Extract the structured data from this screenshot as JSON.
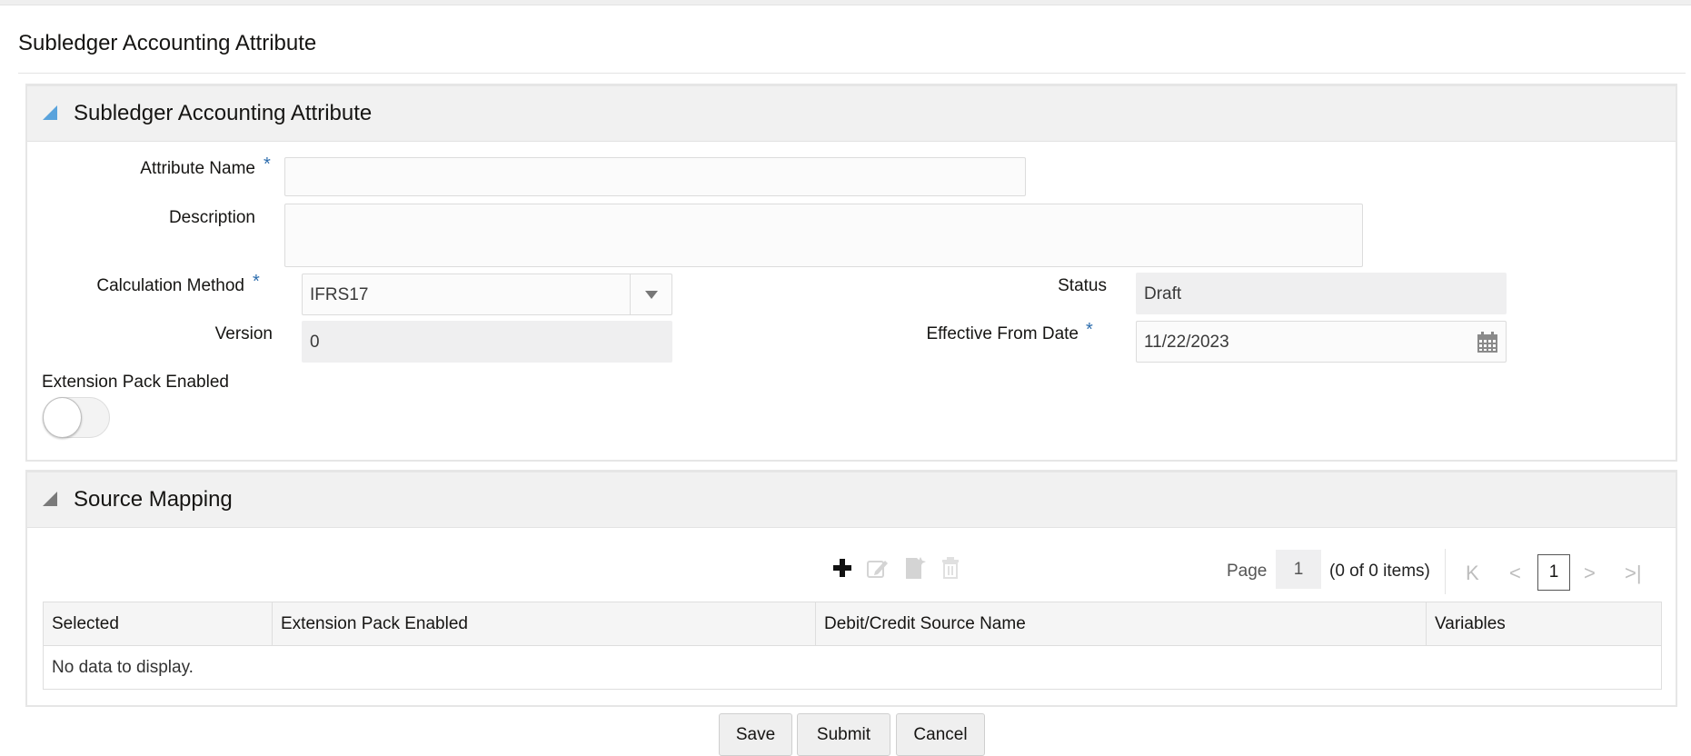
{
  "page": {
    "title": "Subledger Accounting Attribute"
  },
  "details_panel": {
    "title": "Subledger Accounting Attribute",
    "attribute_name": {
      "label": "Attribute Name",
      "required": "*",
      "value": ""
    },
    "description": {
      "label": "Description",
      "value": ""
    },
    "calculation_method": {
      "label": "Calculation Method",
      "required": "*",
      "value": "IFRS17"
    },
    "version": {
      "label": "Version",
      "value": "0"
    },
    "status": {
      "label": "Status",
      "value": "Draft"
    },
    "effective_from_date": {
      "label": "Effective From Date",
      "required": "*",
      "value": "11/22/2023"
    },
    "extension_pack_enabled": {
      "label": "Extension Pack Enabled",
      "checked": false
    }
  },
  "source_mapping_panel": {
    "title": "Source Mapping",
    "toolbar": {
      "add": "add-icon",
      "edit": "edit-icon",
      "copy": "copy-icon",
      "delete": "delete-icon"
    },
    "pager": {
      "page_label": "Page",
      "page_value": "1",
      "items_summary": "(0 of 0 items)",
      "first": "K",
      "prev": "<",
      "current": "1",
      "next": ">",
      "last": ">|"
    },
    "table": {
      "columns": [
        "Selected",
        "Extension Pack Enabled",
        "Debit/Credit Source Name",
        "Variables"
      ],
      "rows": [],
      "empty_text": "No data to display."
    }
  },
  "actions": {
    "save": "Save",
    "submit": "Submit",
    "cancel": "Cancel"
  },
  "colors": {
    "accent": "#2d6dad",
    "expand_triangle": "#5aa3dc",
    "header_bg": "#f1f1f1"
  }
}
